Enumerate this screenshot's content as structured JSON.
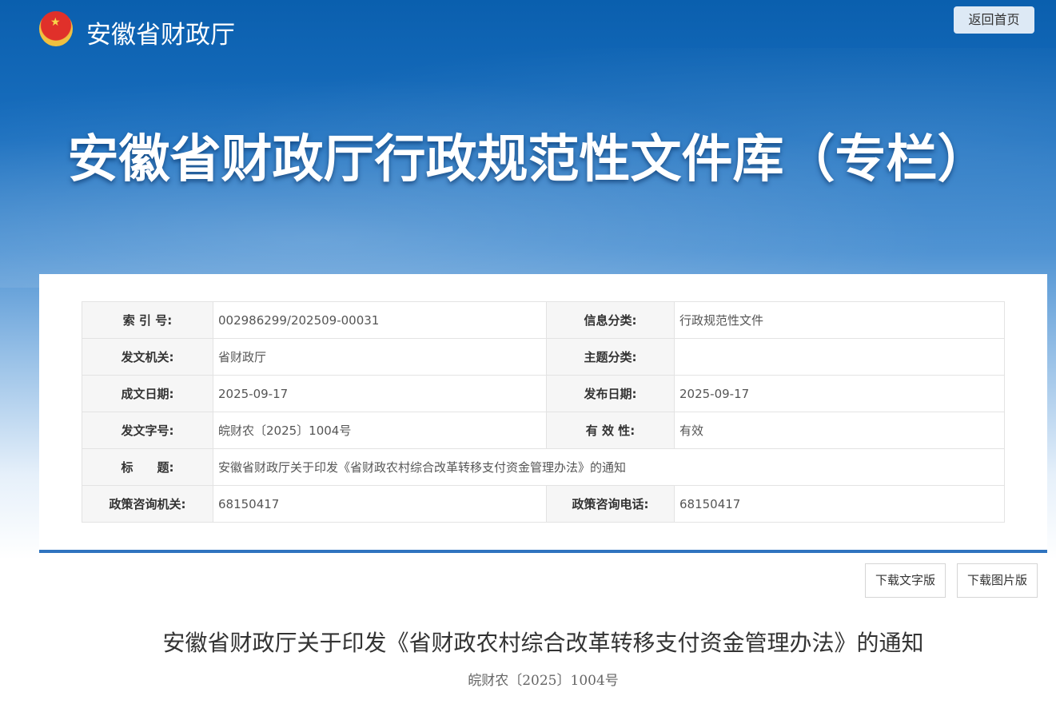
{
  "header": {
    "site_name": "安徽省财政厅",
    "home_button": "返回首页",
    "banner_title": "安徽省财政厅行政规范性文件库（专栏）"
  },
  "info": {
    "rows": [
      {
        "l1": "索 引 号:",
        "v1": "002986299/202509-00031",
        "l2": "信息分类:",
        "v2": "行政规范性文件"
      },
      {
        "l1": "发文机关:",
        "v1": "省财政厅",
        "l2": "主题分类:",
        "v2": ""
      },
      {
        "l1": "成文日期:",
        "v1": "2025-09-17",
        "l2": "发布日期:",
        "v2": "2025-09-17"
      },
      {
        "l1": "发文字号:",
        "v1": "皖财农〔2025〕1004号",
        "l2": "有 效 性:",
        "v2": "有效"
      },
      {
        "l1": "标　　题:",
        "v1": "安徽省财政厅关于印发《省财政农村综合改革转移支付资金管理办法》的通知"
      },
      {
        "l1": "政策咨询机关:",
        "v1": "68150417",
        "l2": "政策咨询电话:",
        "v2": "68150417"
      }
    ]
  },
  "actions": {
    "download_text": "下载文字版",
    "download_image": "下载图片版"
  },
  "document": {
    "title": "安徽省财政厅关于印发《省财政农村综合改革转移支付资金管理办法》的通知",
    "number": "皖财农〔2025〕1004号"
  }
}
